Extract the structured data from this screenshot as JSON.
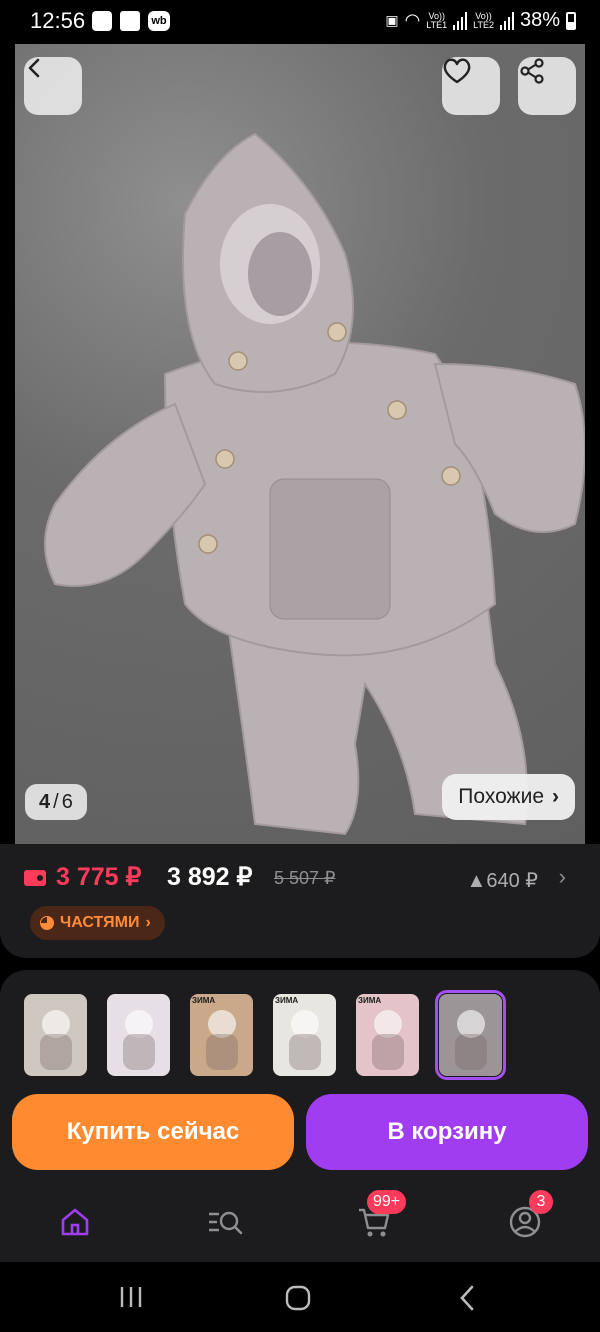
{
  "status_bar": {
    "time": "12:56",
    "network_1": "Vo))\nLTE1",
    "network_2": "Vo))\nLTE2",
    "battery": "38%"
  },
  "gallery": {
    "counter_current": "4",
    "counter_separator": "/",
    "counter_total": "6",
    "similar_label": "Похожие",
    "similar_chevron": "›"
  },
  "price": {
    "wallet_price": "3 775 ₽",
    "price": "3 892 ₽",
    "old_price": "5 507 ₽",
    "delta": "▲640 ₽",
    "chevron": "›",
    "installments_label": "ЧАСТЯМИ",
    "installments_chevron": "›"
  },
  "thumbnails": [
    {
      "tag": "",
      "bg": "#cfc8c0",
      "selected": false
    },
    {
      "tag": "",
      "bg": "#e6e0e6",
      "selected": false
    },
    {
      "tag": "ЗИМА",
      "bg": "#c9a98a",
      "selected": false
    },
    {
      "tag": "ЗИМА",
      "bg": "#e8e6e0",
      "selected": false
    },
    {
      "tag": "ЗИМА",
      "bg": "#e4c4c8",
      "selected": false
    },
    {
      "tag": "",
      "bg": "#9b9597",
      "selected": true
    }
  ],
  "actions": {
    "buy_now": "Купить сейчас",
    "add_to_cart": "В корзину"
  },
  "tabbar": {
    "cart_badge": "99+",
    "profile_badge": "3"
  },
  "colors": {
    "accent_purple": "#a03df1",
    "accent_orange": "#ff8a2f",
    "price_red": "#ff3b5c"
  }
}
